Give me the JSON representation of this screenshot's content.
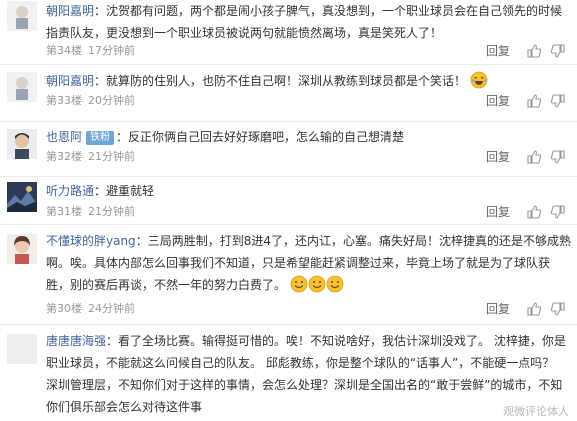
{
  "comments": [
    {
      "user": "朝阳嘉明",
      "text_lines": [
        "：沈贺都有问题，两个都是闹小孩子脾气，真没想到，一个职业球员会在自己领先的时候",
        "指责队友，更没想到一个职业球员被说两句就能愤然离场，真是笑死人了！"
      ],
      "floor": "第34楼",
      "time": "17分钟前",
      "reply": "回复"
    },
    {
      "user": "朝阳嘉明",
      "text": "：就算防的住别人，也防不住自己啊！深圳从教练到球员都是个笑话！",
      "emoji": "laughing-tears-emoji",
      "floor": "第33楼",
      "time": "20分钟前",
      "reply": "回复"
    },
    {
      "user": "也恩阿",
      "badge": "铁粉",
      "text": "：反正你俩自己回去好好琢磨吧，怎么输的自己想清楚",
      "floor": "第32楼",
      "time": "21分钟前",
      "reply": "回复"
    },
    {
      "user": "听力路通",
      "text": "：避重就轻",
      "floor": "第31楼",
      "time": "21分钟前",
      "reply": "回复"
    },
    {
      "user": "不懂球的胖yang",
      "text_lines": [
        "：三局两胜制，打到8进4了，还内讧，心塞。痛失好局！沈梓捷真的还是不够成熟",
        "啊。唉。具体内部怎么回事我们不知道，只是希望能赶紧调整过来，毕竟上场了就是为了球队获",
        "胜，别的赛后再谈，不然一年的努力白费了。"
      ],
      "emoji": "smile-emoji",
      "floor": "第30楼",
      "time": "24分钟前",
      "reply": "回复"
    },
    {
      "user": "唐唐唐海强",
      "text_lines": [
        "：看了全场比赛。输得挺可惜的。唉！不知说啥好，我估计深圳没戏了。 沈梓捷，你是",
        "职业球员，不能就这么问候自己的队友。 邱彪教练，你是整个球队的“话事人”，不能硬一点吗？",
        "深圳管理层，不知你们对于这样的事情，会怎么处理？深圳是全国出名的“敢于尝鲜”的城市，不知",
        "你们俱乐部会怎么对待这件事"
      ]
    }
  ],
  "watermark": "观微评论体人",
  "colors": {
    "username": "#406599",
    "badge": "#6ea5d9",
    "meta": "#999999"
  }
}
